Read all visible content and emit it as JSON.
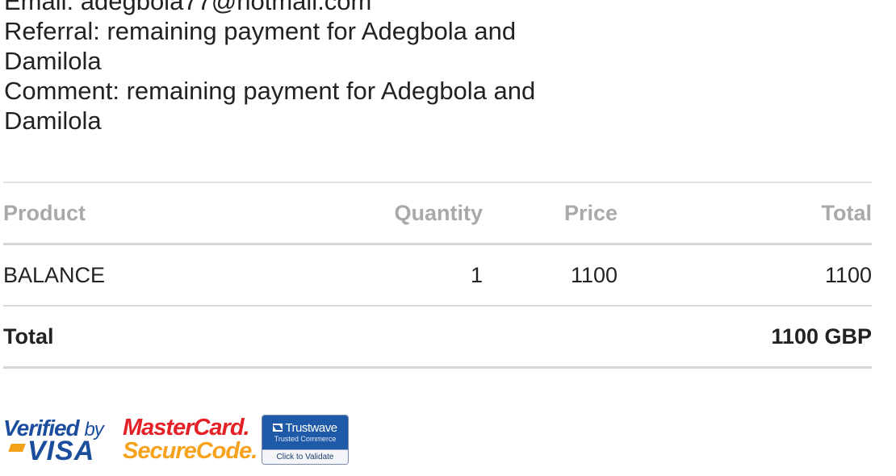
{
  "info": {
    "email_line": "Email: adegbola77@hotmail.com",
    "referral_line1": "Referral: remaining payment for Adegbola and",
    "referral_line2": "Damilola",
    "comment_line1": "Comment: remaining payment for Adegbola and",
    "comment_line2": "Damilola"
  },
  "table": {
    "headers": {
      "product": "Product",
      "quantity": "Quantity",
      "price": "Price",
      "total": "Total"
    },
    "rows": [
      {
        "product": "BALANCE",
        "quantity": "1",
        "price": "1100",
        "total": "1100"
      }
    ],
    "summary": {
      "label": "Total",
      "value": "1100 GBP"
    }
  },
  "badges": {
    "vbv": {
      "line1": "Verified",
      "by": "by",
      "line2": "VISA",
      "icon": "verified-by-visa-logo"
    },
    "mastercard": {
      "line1": "MasterCard.",
      "line2": "SecureCode.",
      "icon": "mastercard-securecode-logo"
    },
    "trustwave": {
      "brand": "Trustwave",
      "sub": "Trusted Commerce",
      "action": "Click to Validate",
      "icon": "trustwave-seal"
    }
  },
  "colors": {
    "header_text": "#a9a9a9",
    "visa_blue": "#1a4d9c",
    "visa_gold": "#f4a11a",
    "mastercard_red": "#e42126",
    "mastercard_orange": "#f6a21c",
    "trustwave_blue": "#1f5aa8"
  }
}
